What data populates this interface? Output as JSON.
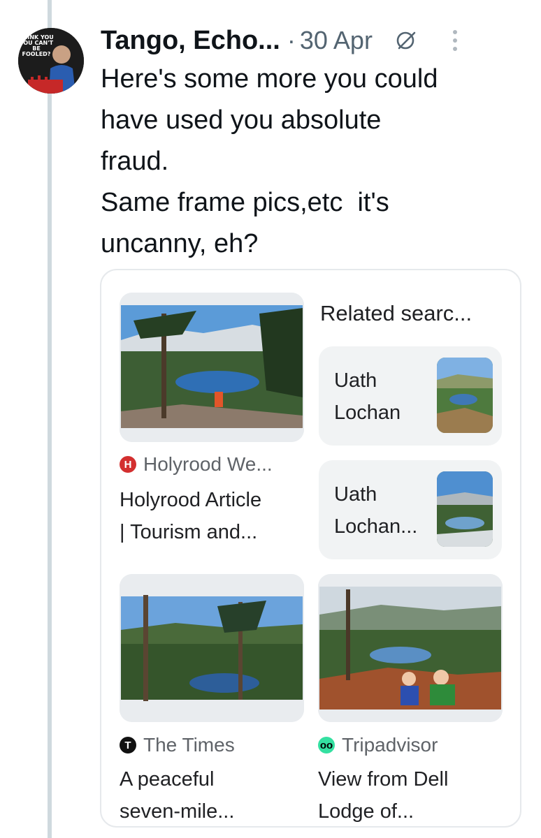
{
  "tweet": {
    "avatar_text": "THINK YOU YOU CAN'T BE FOOLED?",
    "author_name": "Tango, Echo...",
    "separator": "·",
    "date": "30 Apr",
    "grok_icon": "grok-icon",
    "more_icon": "more-vertical-icon",
    "text_lines": [
      "Here's some more you could",
      "have used you absolute",
      "fraud.",
      "Same frame pics,etc  it's",
      "uncanny, eh?"
    ]
  },
  "search_card": {
    "results": [
      {
        "source_name": "Holyrood We...",
        "source_icon": "holyrood-logo-icon",
        "source_color": "#d32f2f",
        "title_lines": [
          "Holyrood Article",
          "| Tourism and..."
        ]
      },
      {
        "source_name": "The Times",
        "source_icon": "the-times-logo-icon",
        "source_color": "#111111",
        "title_lines": [
          "A peaceful",
          "seven-mile..."
        ]
      },
      {
        "source_name": "Tripadvisor",
        "source_icon": "tripadvisor-logo-icon",
        "source_color": "#34e0a1",
        "title_lines": [
          "View from Dell",
          "Lodge of..."
        ]
      }
    ],
    "related": {
      "heading": "Related searc...",
      "items": [
        {
          "label_lines": [
            "Uath",
            "Lochan"
          ]
        },
        {
          "label_lines": [
            "Uath",
            "Lochan..."
          ]
        }
      ]
    }
  }
}
